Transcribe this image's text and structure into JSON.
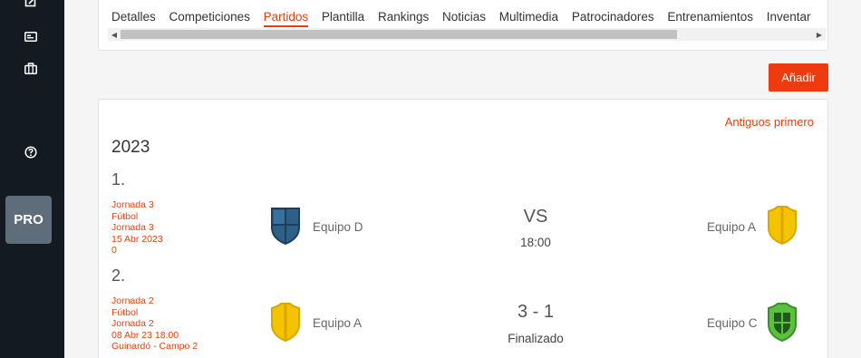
{
  "sidebar": {
    "icons": [
      {
        "name": "edit-icon"
      },
      {
        "name": "billing-icon"
      },
      {
        "name": "briefcase-icon"
      },
      {
        "name": "help-icon"
      }
    ],
    "pro_label": "PRO"
  },
  "tabs": [
    {
      "label": "Detalles"
    },
    {
      "label": "Competiciones"
    },
    {
      "label": "Partidos",
      "active": true
    },
    {
      "label": "Plantilla"
    },
    {
      "label": "Rankings"
    },
    {
      "label": "Noticias"
    },
    {
      "label": "Multimedia"
    },
    {
      "label": "Patrocinadores"
    },
    {
      "label": "Entrenamientos"
    },
    {
      "label": "Inventar"
    }
  ],
  "toolbar": {
    "add_label": "Añadir"
  },
  "list": {
    "sort_label": "Antiguos primero",
    "year": "2023",
    "matches": [
      {
        "number": "1.",
        "info": [
          "Jornada 3",
          "Fútbol",
          "Jornada 3",
          "15 Abr 2023",
          "0"
        ],
        "home_team": "Equipo D",
        "away_team": "Equipo A",
        "center_main": "VS",
        "center_sub": "18:00"
      },
      {
        "number": "2.",
        "info": [
          "Jornada 2",
          "Fútbol",
          "Jornada 2",
          "08 Abr 23 18:00",
          "Guinardó - Campo 2"
        ],
        "home_team": "Equipo A",
        "away_team": "Equipo C",
        "center_main": "3 - 1",
        "center_sub": "Finalizado"
      }
    ]
  },
  "colors": {
    "accent": "#e8400c",
    "sidebar_bg": "#141a22",
    "pro_bg": "#5f6d7a",
    "team_blue": "#2e5f86",
    "team_yellow": "#f5c400",
    "team_green": "#5bbf3f"
  }
}
